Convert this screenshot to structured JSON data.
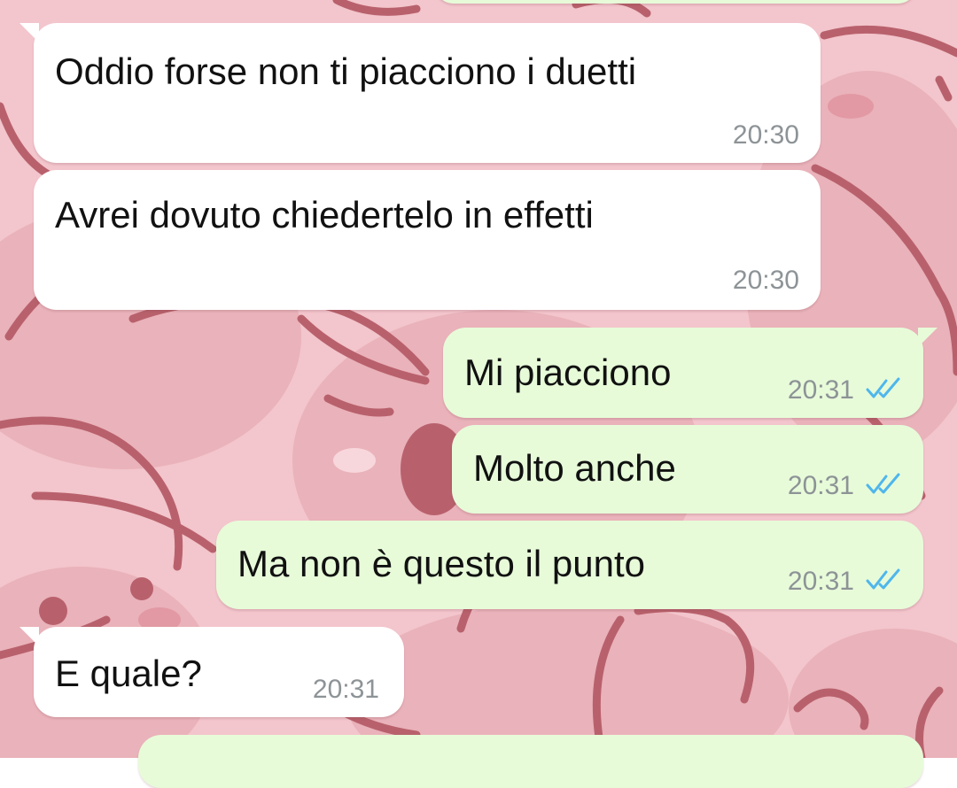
{
  "theme": {
    "wallpaper_base": "#f3c5cc",
    "wallpaper_pattern": "#b8616c",
    "incoming_bubble": "#ffffff",
    "outgoing_bubble": "#e7fbd9",
    "read_ticks": "#4fb6ec",
    "text": "#111111",
    "timestamp": "#8d9396"
  },
  "conversation": {
    "messages": [
      {
        "direction": "incoming",
        "text": "Oddio forse non ti piacciono i duetti",
        "time": "20:30"
      },
      {
        "direction": "incoming",
        "text": "Avrei dovuto chiedertelo in effetti",
        "time": "20:30"
      },
      {
        "direction": "outgoing",
        "text": "Mi piacciono",
        "time": "20:31",
        "status_icon": "double-check-read-icon"
      },
      {
        "direction": "outgoing",
        "text": "Molto anche",
        "time": "20:31",
        "status_icon": "double-check-read-icon"
      },
      {
        "direction": "outgoing",
        "text": "Ma non è questo il punto",
        "time": "20:31",
        "status_icon": "double-check-read-icon"
      },
      {
        "direction": "incoming",
        "text": "E quale?",
        "time": "20:31"
      }
    ]
  }
}
